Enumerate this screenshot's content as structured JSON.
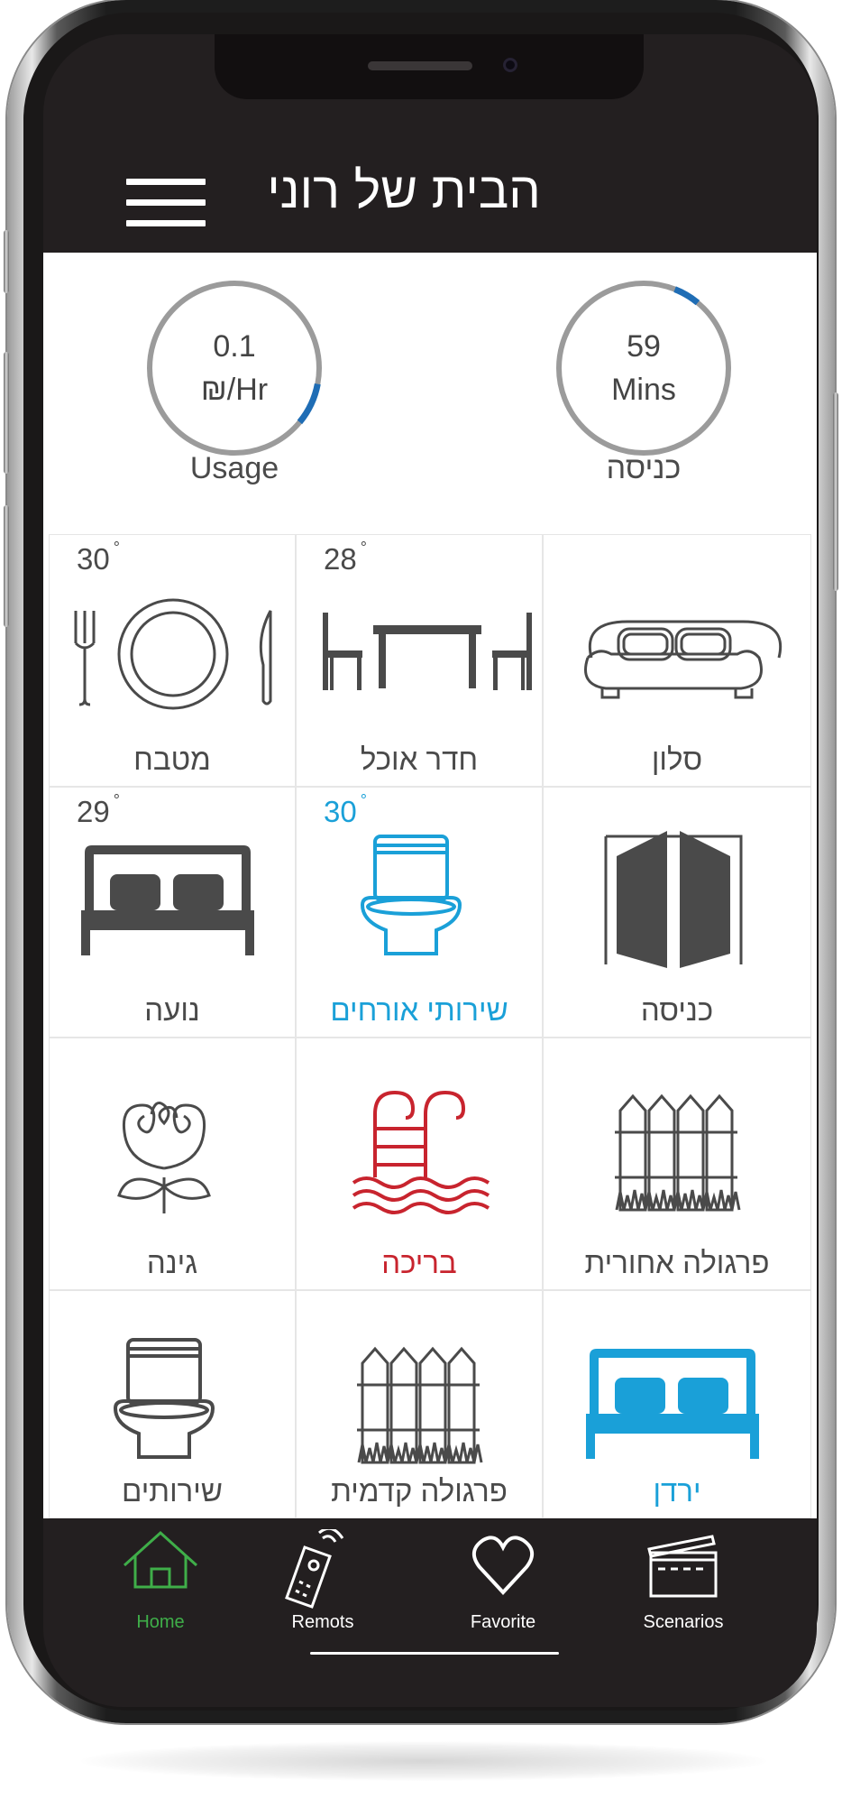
{
  "header": {
    "title": "הבית של רוני",
    "menu_icon": "hamburger-icon"
  },
  "gauges": [
    {
      "id": "usage",
      "line1": "0.1",
      "line2": "₪/Hr",
      "label": "Usage",
      "progress": 0.08,
      "color": "#1f6db5"
    },
    {
      "id": "entrance",
      "line1": "59",
      "line2": "Mins",
      "label": "כניסה",
      "progress": 0.05,
      "color": "#1f6db5"
    }
  ],
  "rooms": [
    {
      "label": "מטבח",
      "icon": "plate-cutlery-icon",
      "temp": "30",
      "color": "#4a4a4a"
    },
    {
      "label": "חדר אוכל",
      "icon": "dining-table-icon",
      "temp": "28",
      "color": "#4a4a4a"
    },
    {
      "label": "סלון",
      "icon": "sofa-icon",
      "temp": "",
      "color": "#4a4a4a"
    },
    {
      "label": "נועה",
      "icon": "bed-icon",
      "temp": "29",
      "color": "#4a4a4a"
    },
    {
      "label": "שירותי אורחים",
      "icon": "toilet-icon",
      "temp": "30",
      "color": "#1aa0d8"
    },
    {
      "label": "כניסה",
      "icon": "door-icon",
      "temp": "",
      "color": "#4a4a4a"
    },
    {
      "label": "גינה",
      "icon": "flower-icon",
      "temp": "",
      "color": "#4a4a4a"
    },
    {
      "label": "בריכה",
      "icon": "pool-ladder-icon",
      "temp": "",
      "color": "#c8242e"
    },
    {
      "label": "פרגולה אחורית",
      "icon": "fence-icon",
      "temp": "",
      "color": "#4a4a4a"
    },
    {
      "label": "שירותים",
      "icon": "toilet-icon",
      "temp": "",
      "color": "#4a4a4a"
    },
    {
      "label": "פרגולה קדמית",
      "icon": "fence-icon",
      "temp": "",
      "color": "#4a4a4a"
    },
    {
      "label": "ירדן",
      "icon": "bed-icon",
      "temp": "",
      "color": "#1aa0d8"
    }
  ],
  "nav": [
    {
      "label": "Home",
      "icon": "home-icon",
      "active": true,
      "color": "#3fae49"
    },
    {
      "label": "Remots",
      "icon": "remote-icon",
      "active": false,
      "color": "#ffffff"
    },
    {
      "label": "Favorite",
      "icon": "heart-icon",
      "active": false,
      "color": "#ffffff"
    },
    {
      "label": "Scenarios",
      "icon": "clapperboard-icon",
      "active": false,
      "color": "#ffffff"
    }
  ],
  "colors": {
    "header_bg": "#231f20",
    "accent_blue": "#1aa0d8",
    "accent_red": "#c8242e",
    "active_green": "#3fae49",
    "gauge_ring": "#9b9b9b"
  }
}
